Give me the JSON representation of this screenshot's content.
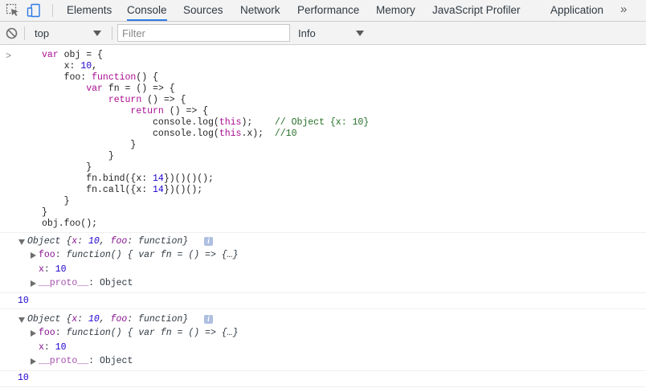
{
  "tabs": [
    {
      "label": "Elements",
      "active": false
    },
    {
      "label": "Console",
      "active": true
    },
    {
      "label": "Sources",
      "active": false
    },
    {
      "label": "Network",
      "active": false
    },
    {
      "label": "Performance",
      "active": false
    },
    {
      "label": "Memory",
      "active": false
    },
    {
      "label": "JavaScript Profiler",
      "active": false
    },
    {
      "label": "Application",
      "active": false
    }
  ],
  "tab_more": "»",
  "toolbar": {
    "context_value": "top",
    "filter_placeholder": "Filter",
    "level_value": "Info"
  },
  "console": {
    "prompt": ">",
    "code_lines": [
      "var obj = {",
      "    x: 10,",
      "    foo: function() {",
      "        var fn = () => {",
      "            return () => {",
      "                return () => {",
      "                    console.log(this);    // Object {x: 10}",
      "                    console.log(this.x);  //10",
      "                }",
      "            }",
      "        }",
      "        fn.bind({x: 14})()()();",
      "        fn.call({x: 14})()();",
      "    }",
      "}",
      "obj.foo();"
    ],
    "outputs": [
      {
        "summary_prefix": "Object ",
        "summary_body": "{x: 10, foo: function}",
        "foo_key": "foo",
        "foo_val": "function() { var fn = () => {…}",
        "x_key": "x",
        "x_val": "10",
        "proto_key": "__proto__",
        "proto_val": "Object",
        "log": "10"
      },
      {
        "summary_prefix": "Object ",
        "summary_body": "{x: 10, foo: function}",
        "foo_key": "foo",
        "foo_val": "function() { var fn = () => {…}",
        "x_key": "x",
        "x_val": "10",
        "proto_key": "__proto__",
        "proto_val": "Object",
        "log": "10"
      }
    ]
  },
  "icons": {
    "inspect": "inspect-element-icon",
    "device": "device-toolbar-icon",
    "clear": "clear-console-icon"
  }
}
